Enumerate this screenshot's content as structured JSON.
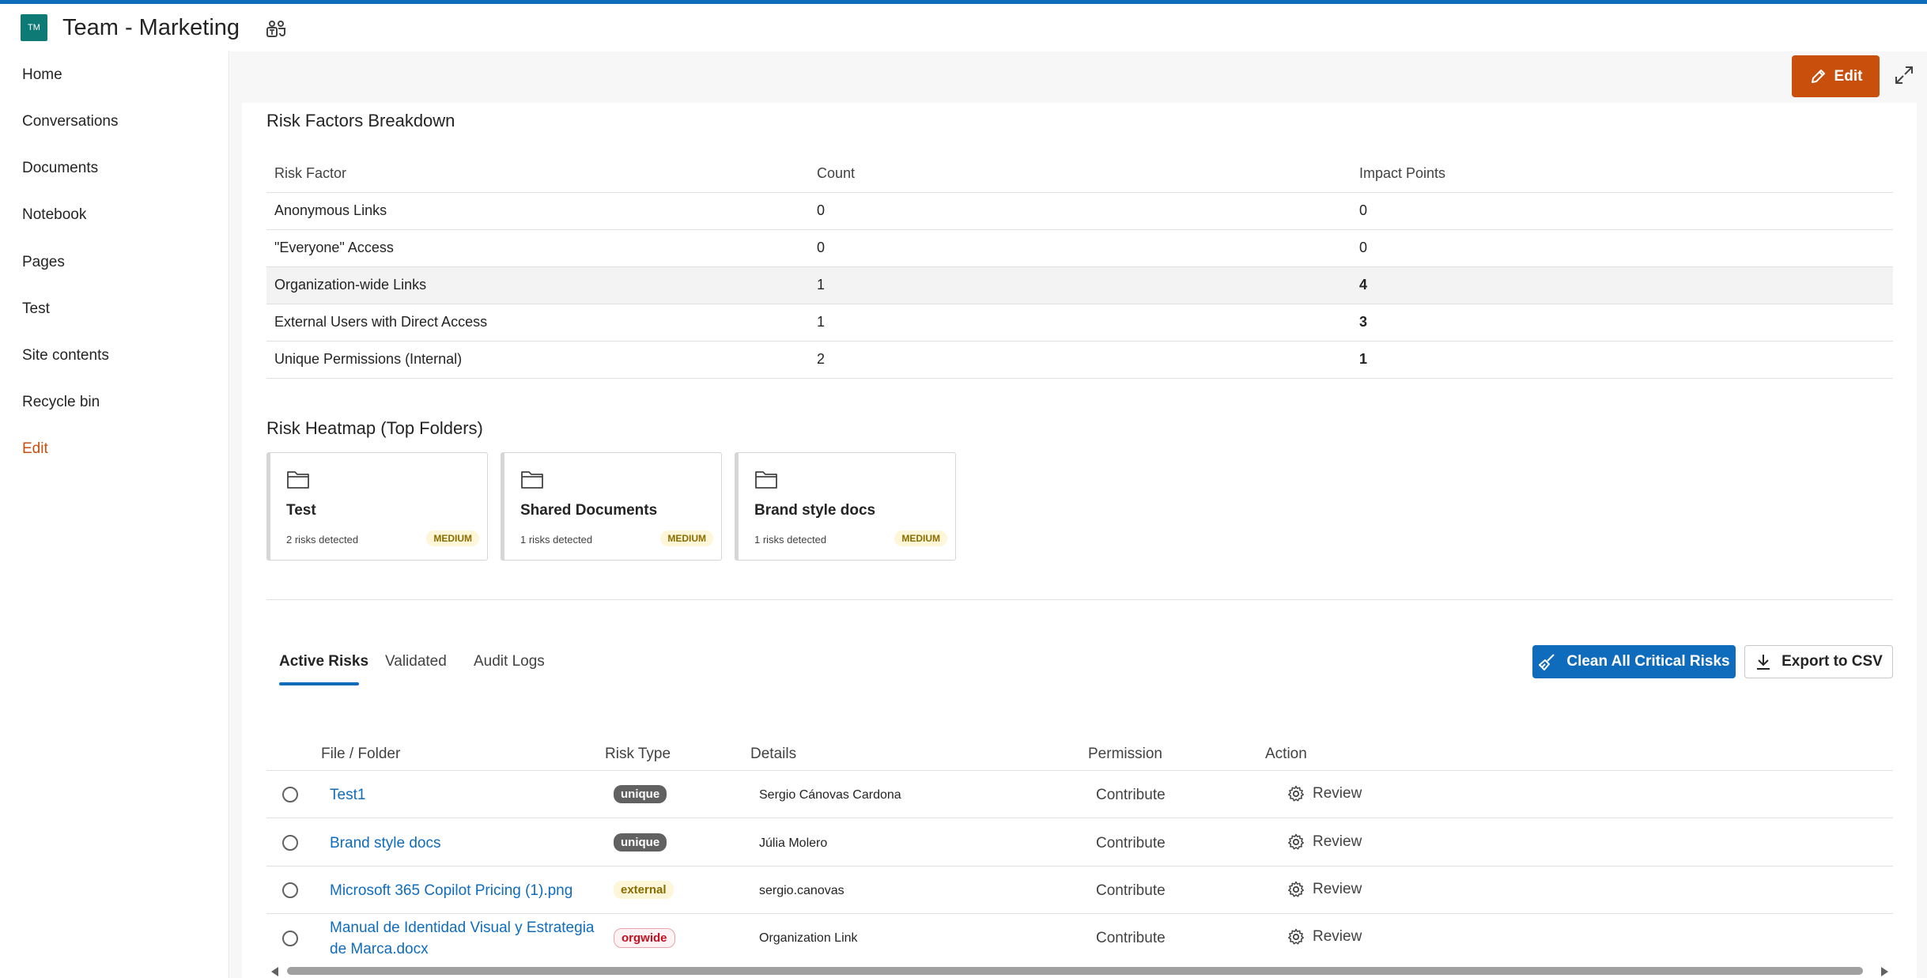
{
  "site": {
    "logo_initials": "TM",
    "title": "Team - Marketing"
  },
  "sidebar": {
    "items": [
      {
        "label": "Home"
      },
      {
        "label": "Conversations"
      },
      {
        "label": "Documents"
      },
      {
        "label": "Notebook"
      },
      {
        "label": "Pages"
      },
      {
        "label": "Test"
      },
      {
        "label": "Site contents"
      },
      {
        "label": "Recycle bin"
      },
      {
        "label": "Edit"
      }
    ]
  },
  "toolbar": {
    "edit_label": "Edit"
  },
  "risk_factors": {
    "title": "Risk Factors Breakdown",
    "headers": [
      "Risk Factor",
      "Count",
      "Impact Points"
    ],
    "rows": [
      {
        "factor": "Anonymous Links",
        "count": "0",
        "impact": "0"
      },
      {
        "factor": "\"Everyone\" Access",
        "count": "0",
        "impact": "0"
      },
      {
        "factor": "Organization-wide Links",
        "count": "1",
        "impact": "4"
      },
      {
        "factor": "External Users with Direct Access",
        "count": "1",
        "impact": "3"
      },
      {
        "factor": "Unique Permissions (Internal)",
        "count": "2",
        "impact": "1"
      }
    ]
  },
  "heatmap": {
    "title": "Risk Heatmap (Top Folders)",
    "cards": [
      {
        "name": "Test",
        "count": "2 risks detected",
        "level": "MEDIUM"
      },
      {
        "name": "Shared Documents",
        "count": "1 risks detected",
        "level": "MEDIUM"
      },
      {
        "name": "Brand style docs",
        "count": "1 risks detected",
        "level": "MEDIUM"
      }
    ]
  },
  "tabs": [
    {
      "label": "Active Risks"
    },
    {
      "label": "Validated"
    },
    {
      "label": "Audit Logs"
    }
  ],
  "actions": {
    "clean_label": "Clean All Critical Risks",
    "export_label": "Export to CSV"
  },
  "grid": {
    "headers": {
      "file": "File / Folder",
      "type": "Risk Type",
      "details": "Details",
      "permission": "Permission",
      "action": "Action"
    },
    "rows": [
      {
        "file": "Test1",
        "type": "unique",
        "details": "Sergio Cánovas Cardona",
        "permission": "Contribute",
        "action": "Review"
      },
      {
        "file": "Brand style docs",
        "type": "unique",
        "details": "Júlia Molero",
        "permission": "Contribute",
        "action": "Review"
      },
      {
        "file": "Microsoft 365 Copilot Pricing (1).png",
        "type": "external",
        "details": "sergio.canovas",
        "permission": "Contribute",
        "action": "Review"
      },
      {
        "file": "Manual de Identidad Visual y Estrategia de Marca.docx",
        "type": "orgwide",
        "details": "Organization Link",
        "permission": "Contribute",
        "action": "Review"
      }
    ]
  },
  "colors": {
    "accent": "#0f6cbd",
    "edit_orange": "#c84f0c",
    "site_logo": "#0e7a75",
    "impact_red": "#c50f1f"
  }
}
